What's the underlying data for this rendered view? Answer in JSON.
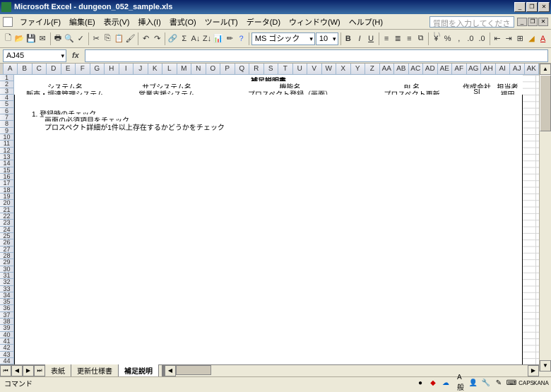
{
  "window": {
    "title": "Microsoft Excel - dungeon_052_sample.xls",
    "minimize": "_",
    "restore": "❐",
    "close": "✕"
  },
  "menu": {
    "file": "ファイル(F)",
    "edit": "編集(E)",
    "view": "表示(V)",
    "insert": "挿入(I)",
    "format": "書式(O)",
    "tools": "ツール(T)",
    "data": "データ(D)",
    "window": "ウィンドウ(W)",
    "help": "ヘルプ(H)",
    "question_placeholder": "質問を入力してください"
  },
  "toolbar": {
    "font": "MS ゴシック",
    "size": "10"
  },
  "namebox": "AJ45",
  "fx": "fx",
  "columns": [
    "A",
    "B",
    "C",
    "D",
    "E",
    "F",
    "G",
    "H",
    "I",
    "J",
    "K",
    "L",
    "M",
    "N",
    "O",
    "P",
    "Q",
    "R",
    "S",
    "T",
    "U",
    "V",
    "W",
    "X",
    "Y",
    "Z",
    "AA",
    "AB",
    "AC",
    "AD",
    "AE",
    "AF",
    "AG",
    "AH",
    "AI",
    "AJ",
    "AK"
  ],
  "row_count": 45,
  "cells": {
    "title": "補足説明書",
    "hdr_system": "システム名",
    "hdr_subsystem": "サブシステム名",
    "hdr_function": "機能名",
    "hdr_blname": "BL名",
    "hdr_creator": "作成会社",
    "hdr_person": "担当者",
    "val_system": "販売・調達管理システム",
    "val_subsystem": "営業支援システム",
    "val_function": "プロスペクト登録（画面）",
    "val_blname": "プロスペクト更新",
    "val_creator": "SI",
    "val_person": "福田",
    "body1": "1. 登録時のチェック",
    "body2": "画面の必須項目をチェック",
    "body3": "プロスペクト詳細が1件以上存在するかどうかをチェック"
  },
  "tabs": {
    "t1": "表紙",
    "t2": "更新仕様書",
    "t3": "補足説明"
  },
  "status": {
    "ready": "コマンド",
    "ime": "A 般",
    "caps": "CAPS",
    "kana": "KANA"
  }
}
